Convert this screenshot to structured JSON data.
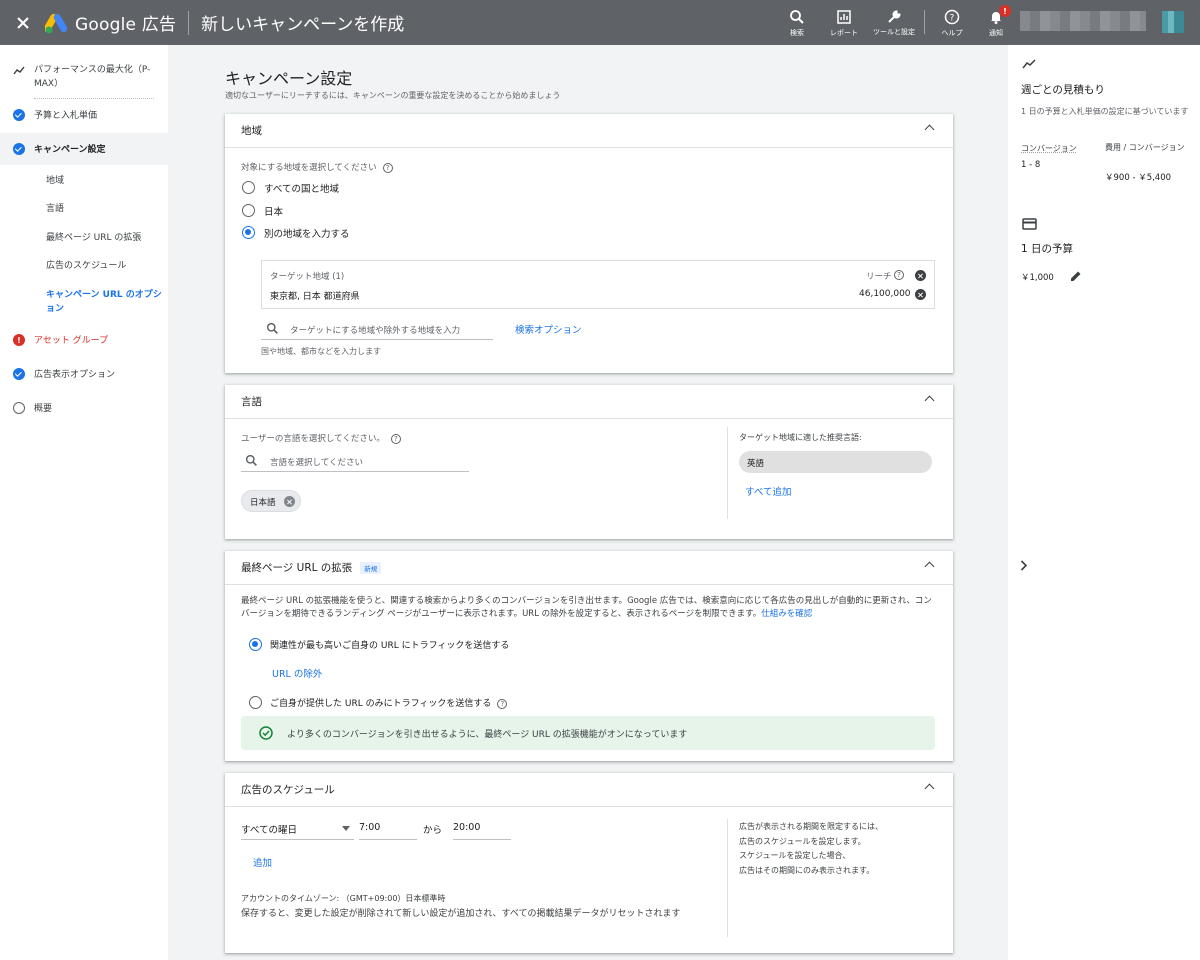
{
  "topbar": {
    "brand": "Google 広告",
    "title": "新しいキャンペーンを作成",
    "tools": [
      {
        "icon": "search-icon",
        "label": "検索"
      },
      {
        "icon": "report-icon",
        "label": "レポート"
      },
      {
        "icon": "wrench-icon",
        "label": "ツールと設定"
      },
      {
        "icon": "help-icon",
        "label": "ヘルプ"
      },
      {
        "icon": "bell-icon",
        "label": "通知",
        "badge": "!"
      }
    ]
  },
  "leftnav": {
    "items": [
      {
        "label": "パフォーマンスの最大化（P-MAX）",
        "status": "trend"
      },
      {
        "label": "予算と入札単価",
        "status": "done"
      },
      {
        "label": "キャンペーン設定",
        "status": "done"
      },
      {
        "label": "アセット グループ",
        "status": "warning"
      },
      {
        "label": "広告表示オプション",
        "status": "done"
      },
      {
        "label": "概要",
        "status": "empty"
      }
    ],
    "subitems": [
      "地域",
      "言語",
      "最終ページ URL の拡張",
      "広告のスケジュール",
      "キャンペーン URL のオプション"
    ]
  },
  "main": {
    "heading": "キャンペーン設定",
    "subheading": "適切なユーザーにリーチするには、キャンペーンの重要な設定を決めることから始めましょう",
    "location": {
      "title": "地域",
      "prompt": "対象にする地域を選択してください",
      "options": [
        "すべての国と地域",
        "日本",
        "別の地域を入力する"
      ],
      "selected_index": 2,
      "target_header": "ターゲット地域 (1)",
      "reach_label": "リーチ",
      "target_name": "東京都, 日本 都道府県",
      "target_reach": "46,100,000",
      "search_placeholder": "ターゲットにする地域や除外する地域を入力",
      "search_options": "検索オプション",
      "search_hint": "国や地域、都市などを入力します"
    },
    "language": {
      "title": "言語",
      "prompt": "ユーザーの言語を選択してください。",
      "search_placeholder": "言語を選択してください",
      "chip": "日本語",
      "suggest_label": "ターゲット地域に適した推奨言語:",
      "suggest_chip": "英語",
      "add_all": "すべて追加"
    },
    "final_url": {
      "title": "最終ページ URL の拡張",
      "new_tag": "新規",
      "description": "最終ページ URL の拡張機能を使うと、関連する検索からより多くのコンバージョンを引き出せます。Google 広告では、検索意向に応じて各広告の見出しが自動的に更新され、コンバージョンを期待できるランディング ページがユーザーに表示されます。URL の除外を設定すると、表示されるページを制限できます。",
      "learn_link": "仕組みを確認",
      "option1": "関連性が最も高いご自身の URL にトラフィックを送信する",
      "url_exclude": "URL の除外",
      "option2": "ご自身が提供した URL のみにトラフィックを送信する",
      "selected_index": 0,
      "banner": "より多くのコンバージョンを引き出せるように、最終ページ URL の拡張機能がオンになっています"
    },
    "schedule": {
      "title": "広告のスケジュール",
      "day": "すべての曜日",
      "start": "7:00",
      "from": "から",
      "end": "20:00",
      "add": "追加",
      "timezone": "アカウントのタイムゾーン: （GMT+09:00）日本標準時",
      "note": "保存すると、変更した設定が削除されて新しい設定が追加され、すべての掲載結果データがリセットされます",
      "side_lines": [
        "広告が表示される期間を限定するには、",
        "広告のスケジュールを設定します。",
        "スケジュールを設定した場合、",
        "広告はその期間にのみ表示されます。"
      ]
    }
  },
  "rightpanel": {
    "weekly_title": "週ごとの見積もり",
    "weekly_desc": "1 日の予算と入札単価の設定に基づいています",
    "conv_label": "コンバージョン",
    "conv_value": "1 - 8",
    "cost_label": "費用 / コンバージョン",
    "cost_value": "￥900 - ￥5,400",
    "budget_title": "1 日の予算",
    "budget_value": "￥1,000"
  },
  "colors": {
    "topbar": "#5f6368",
    "accent": "#1a73e8",
    "warning": "#d93025",
    "banner_bg": "#e6f4ea",
    "success": "#188038"
  }
}
